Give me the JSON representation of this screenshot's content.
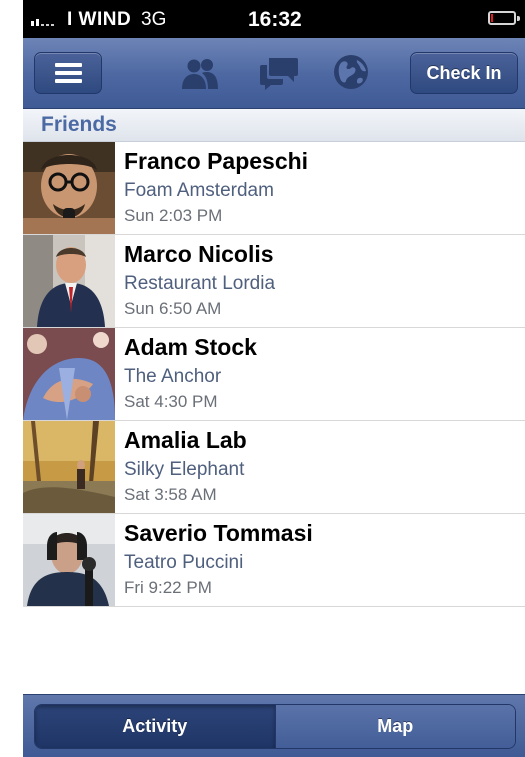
{
  "status_bar": {
    "carrier": "I WIND",
    "network": "3G",
    "time": "16:32",
    "battery_level": 0.1,
    "battery_color": "#e21a1a"
  },
  "nav_bar": {
    "menu_icon": "hamburger-icon",
    "icons": [
      "friends-icon",
      "messages-icon",
      "globe-icon"
    ],
    "check_in_label": "Check In",
    "color": "#4c67a1"
  },
  "section": {
    "title": "Friends"
  },
  "friends": [
    {
      "name": "Franco Papeschi",
      "place": "Foam Amsterdam",
      "time": "Sun 2:03 PM"
    },
    {
      "name": "Marco Nicolis",
      "place": "Restaurant Lordia",
      "time": "Sun 6:50 AM"
    },
    {
      "name": "Adam Stock",
      "place": "The Anchor",
      "time": "Sat 4:30 PM"
    },
    {
      "name": "Amalia Lab",
      "place": "Silky Elephant",
      "time": "Sat 3:58 AM"
    },
    {
      "name": "Saverio Tommasi",
      "place": "Teatro Puccini",
      "time": "Fri 9:22 PM"
    }
  ],
  "bottom_bar": {
    "tabs": [
      {
        "label": "Activity",
        "selected": true
      },
      {
        "label": "Map",
        "selected": false
      }
    ]
  }
}
